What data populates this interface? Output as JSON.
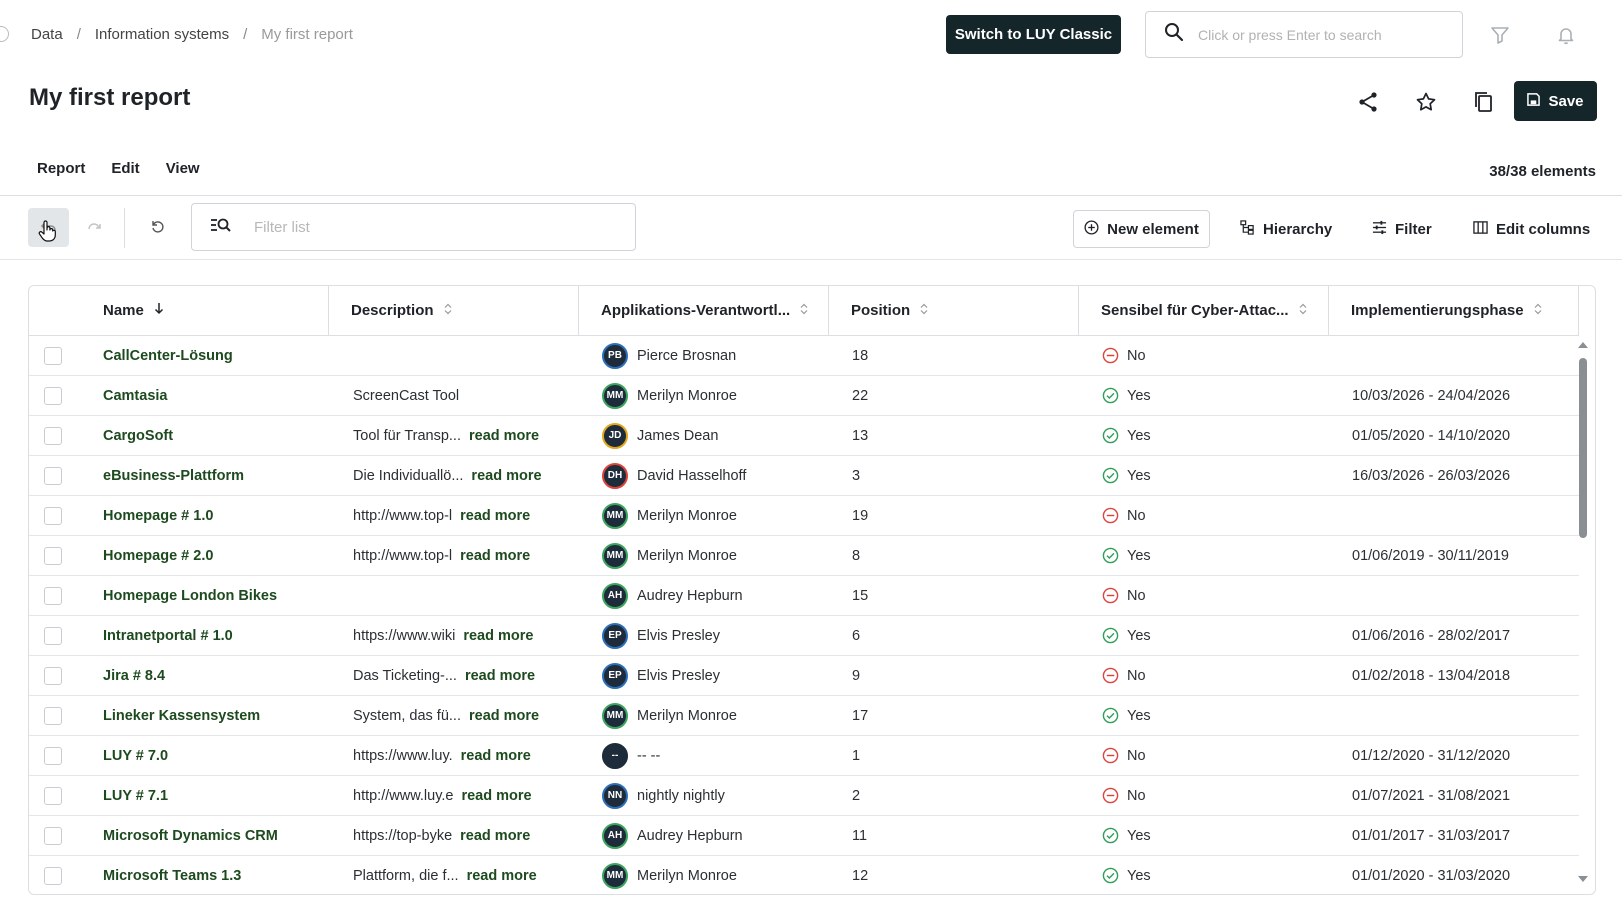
{
  "breadcrumb": {
    "items": [
      "Data",
      "Information systems",
      "My first report"
    ]
  },
  "header": {
    "switch_label": "Switch to LUY Classic",
    "search_placeholder": "Click or press Enter to search"
  },
  "page": {
    "title": "My first report",
    "save_label": "Save"
  },
  "menu": {
    "items": [
      "Report",
      "Edit",
      "View"
    ]
  },
  "element_count": "38/38 elements",
  "toolbar": {
    "filter_placeholder": "Filter list",
    "new_element_label": "New element",
    "hierarchy_label": "Hierarchy",
    "filter_label": "Filter",
    "edit_columns_label": "Edit columns"
  },
  "table": {
    "columns": [
      "Name",
      "Description",
      "Applikations-Verantwortl...",
      "Position",
      "Sensibel für Cyber-Attac...",
      "Implementierungsphase"
    ],
    "read_more": "read more",
    "rows": [
      {
        "name": "CallCenter-Lösung",
        "desc": "",
        "initials": "PB",
        "owner": "Pierce Brosnan",
        "ring": "#2c6fb7",
        "pos": "18",
        "cyber": "No",
        "impl": ""
      },
      {
        "name": "Camtasia",
        "desc": "ScreenCast Tool",
        "initials": "MM",
        "owner": "Merilyn Monroe",
        "ring": "#3aa55d",
        "pos": "22",
        "cyber": "Yes",
        "impl": "10/03/2026 - 24/04/2026"
      },
      {
        "name": "CargoSoft",
        "desc": "Tool für Transp...",
        "initials": "JD",
        "owner": "James Dean",
        "ring": "#e0a81e",
        "pos": "13",
        "cyber": "Yes",
        "impl": "01/05/2020 - 14/10/2020"
      },
      {
        "name": "eBusiness-Plattform",
        "desc": "Die Individuallö...",
        "initials": "DH",
        "owner": "David Hasselhoff",
        "ring": "#d9443b",
        "pos": "3",
        "cyber": "Yes",
        "impl": "16/03/2026 - 26/03/2026"
      },
      {
        "name": "Homepage # 1.0",
        "desc": "http://www.top-l",
        "initials": "MM",
        "owner": "Merilyn Monroe",
        "ring": "#3aa55d",
        "pos": "19",
        "cyber": "No",
        "impl": ""
      },
      {
        "name": "Homepage # 2.0",
        "desc": "http://www.top-l",
        "initials": "MM",
        "owner": "Merilyn Monroe",
        "ring": "#3aa55d",
        "pos": "8",
        "cyber": "Yes",
        "impl": "01/06/2019 - 30/11/2019"
      },
      {
        "name": "Homepage London Bikes",
        "desc": "",
        "initials": "AH",
        "owner": "Audrey Hepburn",
        "ring": "#3aa55d",
        "pos": "15",
        "cyber": "No",
        "impl": ""
      },
      {
        "name": "Intranetportal # 1.0",
        "desc": "https://www.wiki",
        "initials": "EP",
        "owner": "Elvis Presley",
        "ring": "#2c6fb7",
        "pos": "6",
        "cyber": "Yes",
        "impl": "01/06/2016 - 28/02/2017"
      },
      {
        "name": "Jira # 8.4",
        "desc": "Das Ticketing-...",
        "initials": "EP",
        "owner": "Elvis Presley",
        "ring": "#2c6fb7",
        "pos": "9",
        "cyber": "No",
        "impl": "01/02/2018 - 13/04/2018"
      },
      {
        "name": "Lineker Kassensystem",
        "desc": "System, das fü...",
        "initials": "MM",
        "owner": "Merilyn Monroe",
        "ring": "#3aa55d",
        "pos": "17",
        "cyber": "Yes",
        "impl": ""
      },
      {
        "name": "LUY # 7.0",
        "desc": "https://www.luy.",
        "initials": "--",
        "owner": "-- --",
        "ring": "#1d2b3a",
        "pos": "1",
        "cyber": "No",
        "impl": "01/12/2020 - 31/12/2020"
      },
      {
        "name": "LUY # 7.1",
        "desc": "http://www.luy.e",
        "initials": "NN",
        "owner": "nightly nightly",
        "ring": "#2c6fb7",
        "pos": "2",
        "cyber": "No",
        "impl": "01/07/2021 - 31/08/2021"
      },
      {
        "name": "Microsoft Dynamics CRM",
        "desc": "https://top-byke",
        "initials": "AH",
        "owner": "Audrey Hepburn",
        "ring": "#3aa55d",
        "pos": "11",
        "cyber": "Yes",
        "impl": "01/01/2017 - 31/03/2017"
      },
      {
        "name": "Microsoft Teams 1.3",
        "desc": "Plattform, die f...",
        "initials": "MM",
        "owner": "Merilyn Monroe",
        "ring": "#3aa55d",
        "pos": "12",
        "cyber": "Yes",
        "impl": "01/01/2020 - 31/03/2020"
      }
    ]
  },
  "colors": {
    "dark": "#15262b",
    "link_green": "#1d4a1e",
    "yes_green": "#2f9e57",
    "no_red": "#d9443b"
  }
}
